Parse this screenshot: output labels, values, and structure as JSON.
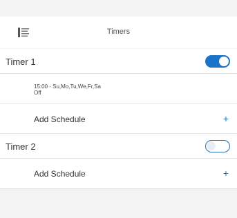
{
  "header": {
    "title": "Timers",
    "menu_icon": "menu-list-icon"
  },
  "timers": [
    {
      "label": "Timer 1",
      "enabled": true,
      "schedules": [
        {
          "time_days": "15:00 - Su,Mo,Tu,We,Fr,Sa",
          "action": "Off"
        }
      ],
      "add_label": "Add Schedule",
      "add_icon": "+"
    },
    {
      "label": "Timer 2",
      "enabled": false,
      "schedules": [],
      "add_label": "Add Schedule",
      "add_icon": "+"
    }
  ],
  "colors": {
    "accent": "#1a73c9",
    "background": "#f3f3f3",
    "row": "#ffffff"
  }
}
